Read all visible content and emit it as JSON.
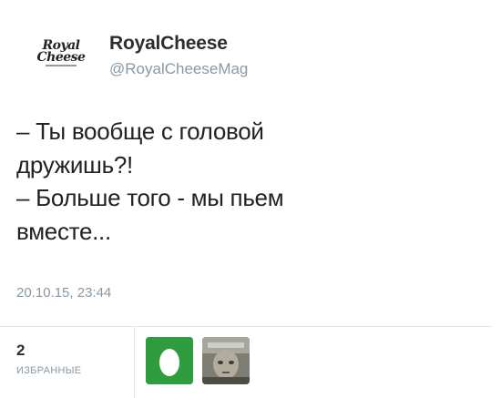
{
  "author": {
    "avatar_lines": [
      "Royal",
      "Cheese"
    ],
    "name": "RoyalCheese",
    "handle": "@RoyalCheeseMag"
  },
  "tweet": {
    "lines": [
      "– Ты вообще с головой",
      "дружишь?!",
      "– Больше того - мы пьем",
      "вместе..."
    ],
    "timestamp": "20.10.15, 23:44"
  },
  "stats": {
    "favorites_count": "2",
    "favorites_label": "ИЗБРАННЫЕ"
  },
  "favoriters": [
    {
      "name": "egg-avatar",
      "color": "#2e9c3f"
    },
    {
      "name": "photo-avatar",
      "color": "#8a8a80"
    }
  ]
}
